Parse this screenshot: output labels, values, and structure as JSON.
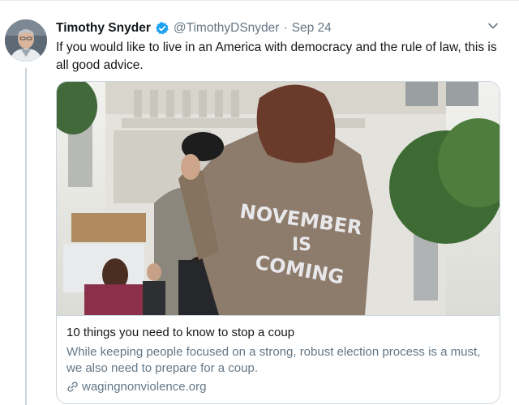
{
  "tweet": {
    "author_name": "Timothy Snyder",
    "handle": "@TimothyDSnyder",
    "separator": "·",
    "date": "Sep 24",
    "text": "If you would like to live in an America with democracy and the rule of law, this is all good advice."
  },
  "card": {
    "image_text": {
      "line1": "NOVEMBER",
      "line2": "IS",
      "line3": "COMING"
    },
    "title": "10 things you need to know to stop a coup",
    "description": "While keeping people focused on a strong, robust election process is a must, we also need to prepare for a coup.",
    "domain": "wagingnonviolence.org"
  },
  "colors": {
    "verified": "#1da1f2",
    "secondary_text": "#657786",
    "border": "#ccd6dd"
  },
  "icons": {
    "verified": "verified-badge-icon",
    "caret": "chevron-down-icon",
    "link": "link-icon"
  }
}
